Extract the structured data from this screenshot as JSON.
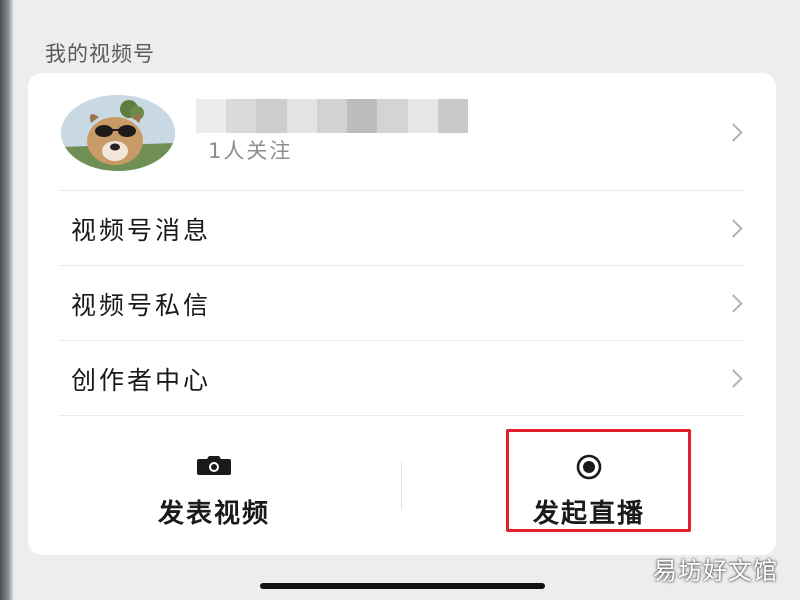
{
  "section": {
    "title": "我的视频号"
  },
  "profile": {
    "follow_text": "1人关注",
    "avatar_icon": "dog-with-sunglasses-avatar",
    "name_blur_colors": [
      "#ececec",
      "#d9d9d9",
      "#cdcdcd",
      "#e3e3e3",
      "#d2d2d2",
      "#bdbdbd",
      "#d4d4d4",
      "#e6e6e6",
      "#c9c9c9"
    ]
  },
  "menu": [
    {
      "label": "视频号消息",
      "icon": "chevron-right-icon"
    },
    {
      "label": "视频号私信",
      "icon": "chevron-right-icon"
    },
    {
      "label": "创作者中心",
      "icon": "chevron-right-icon"
    }
  ],
  "actions": {
    "post_video": {
      "label": "发表视频",
      "icon": "camera-icon"
    },
    "start_live": {
      "label": "发起直播",
      "icon": "live-record-icon"
    }
  },
  "watermark": "易坊好文馆",
  "colors": {
    "highlight": "#e0202a",
    "background": "#ededed",
    "card": "#ffffff"
  }
}
